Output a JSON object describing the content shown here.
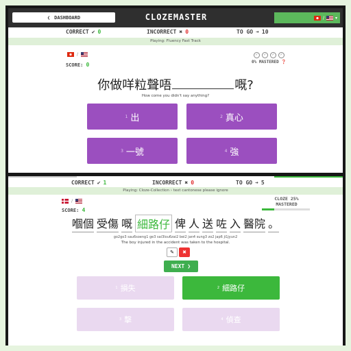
{
  "colors": {
    "accent_green": "#3cb83c",
    "incorrect_red": "#e03030",
    "choice_purple": "#9b4fbf"
  },
  "nav": {
    "dashboard_label": "DASHBOARD",
    "back_icon": "chevron-left-icon",
    "logo": "CLOZEMASTER",
    "lang_icons": [
      "hk-flag-icon",
      "us-flag-icon",
      "chevron-down-icon"
    ]
  },
  "panel1": {
    "stats": {
      "correct_label": "CORRECT",
      "correct_value": "0",
      "incorrect_label": "INCORRECT",
      "incorrect_value": "0",
      "to_go_label": "TO GO",
      "to_go_value": "10"
    },
    "playing": "Playing: Fluency Fast Track",
    "score_label": "SCORE:",
    "score_value": "0",
    "mastered": "0% MASTERED",
    "sentence_before": "你做咩粒聲唔",
    "sentence_after": "嘅?",
    "translation": "How come you didn't say anything?",
    "choices": [
      {
        "num": "1",
        "text": "出"
      },
      {
        "num": "2",
        "text": "真心"
      },
      {
        "num": "3",
        "text": "一號"
      },
      {
        "num": "4",
        "text": "強"
      }
    ]
  },
  "panel2": {
    "stats": {
      "correct_label": "CORRECT",
      "correct_value": "1",
      "incorrect_label": "INCORRECT",
      "incorrect_value": "0",
      "to_go_label": "TO GO",
      "to_go_value": "5"
    },
    "playing": "Playing: Cloze-Collection  ›  text cantonese please ignore",
    "score_label": "SCORE:",
    "score_value": "4",
    "cloze_pct": "CLOZE 25%",
    "mastered_label": "MASTERED",
    "mastered_fraction": 0.25,
    "words": [
      "嗰個",
      "受傷",
      "嘅",
      "細路仔",
      "俾",
      "人",
      "送",
      "咗",
      "入",
      "醫院",
      "。"
    ],
    "answer_word": "細路仔",
    "jyutping": "go2go3 sau6soeng1 ge3 sai3lou6zai2 bei2 jan4 sung3 zo2 jap6 ji1jyun2",
    "translation": "The boy injured in the accident was taken to the hospital.",
    "next_label": "NEXT",
    "choices": [
      {
        "num": "1",
        "text": "損失"
      },
      {
        "num": "2",
        "text": "細路仔"
      },
      {
        "num": "3",
        "text": "擊"
      },
      {
        "num": "4",
        "text": "偵查"
      }
    ]
  }
}
